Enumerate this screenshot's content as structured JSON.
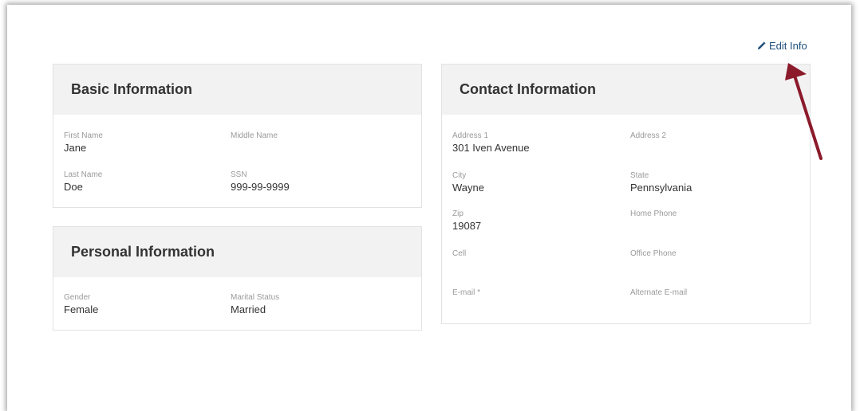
{
  "actions": {
    "edit_label": "Edit Info",
    "edit_icon": "pencil-icon"
  },
  "basic": {
    "title": "Basic Information",
    "fields": [
      {
        "label": "First Name",
        "value": "Jane"
      },
      {
        "label": "Middle Name",
        "value": ""
      },
      {
        "label": "Last Name",
        "value": "Doe"
      },
      {
        "label": "SSN",
        "value": "999-99-9999"
      }
    ]
  },
  "personal": {
    "title": "Personal Information",
    "fields": [
      {
        "label": "Gender",
        "value": "Female"
      },
      {
        "label": "Marital Status",
        "value": "Married"
      }
    ]
  },
  "contact": {
    "title": "Contact Information",
    "fields": [
      {
        "label": "Address 1",
        "value": "301 Iven Avenue"
      },
      {
        "label": "Address 2",
        "value": ""
      },
      {
        "label": "City",
        "value": "Wayne"
      },
      {
        "label": "State",
        "value": "Pennsylvania"
      },
      {
        "label": "Zip",
        "value": "19087"
      },
      {
        "label": "Home Phone",
        "value": ""
      },
      {
        "label": "Cell",
        "value": ""
      },
      {
        "label": "Office Phone",
        "value": ""
      },
      {
        "label": "E-mail *",
        "value": ""
      },
      {
        "label": "Alternate E-mail",
        "value": ""
      }
    ]
  },
  "colors": {
    "link": "#1f4f7a",
    "arrow": "#8b1a2b",
    "header_bg": "#f2f2f2"
  }
}
